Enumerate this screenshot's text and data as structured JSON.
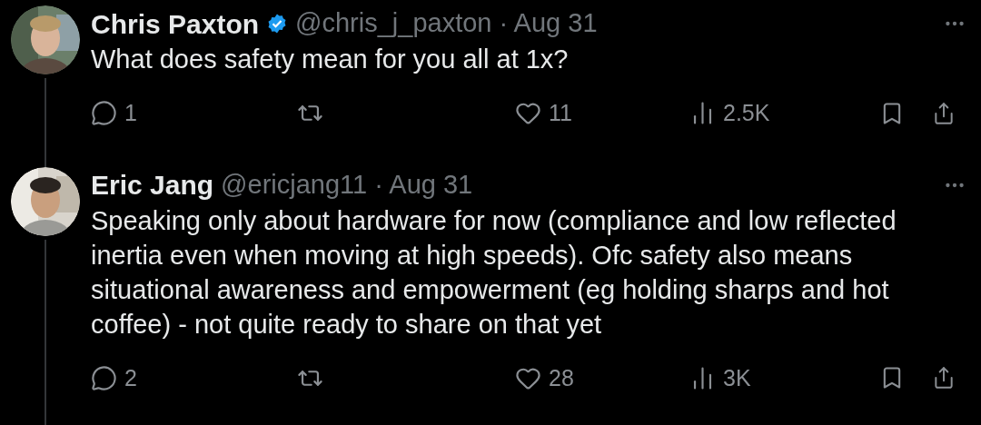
{
  "tweets": [
    {
      "name": "Chris Paxton",
      "verified": true,
      "handle": "@chris_j_paxton",
      "date": "· Aug 31",
      "text": "What does safety mean for you all at 1x?",
      "replies": "1",
      "likes": "11",
      "views": "2.5K"
    },
    {
      "name": "Eric Jang",
      "verified": false,
      "handle": "@ericjang11",
      "date": "· Aug 31",
      "text": "Speaking only about hardware for now (compliance and low reflected inertia even when moving at high speeds). Ofc safety also means situational awareness and empowerment (eg holding sharps and hot coffee) - not quite ready to share on that yet",
      "replies": "2",
      "likes": "28",
      "views": "3K"
    }
  ]
}
